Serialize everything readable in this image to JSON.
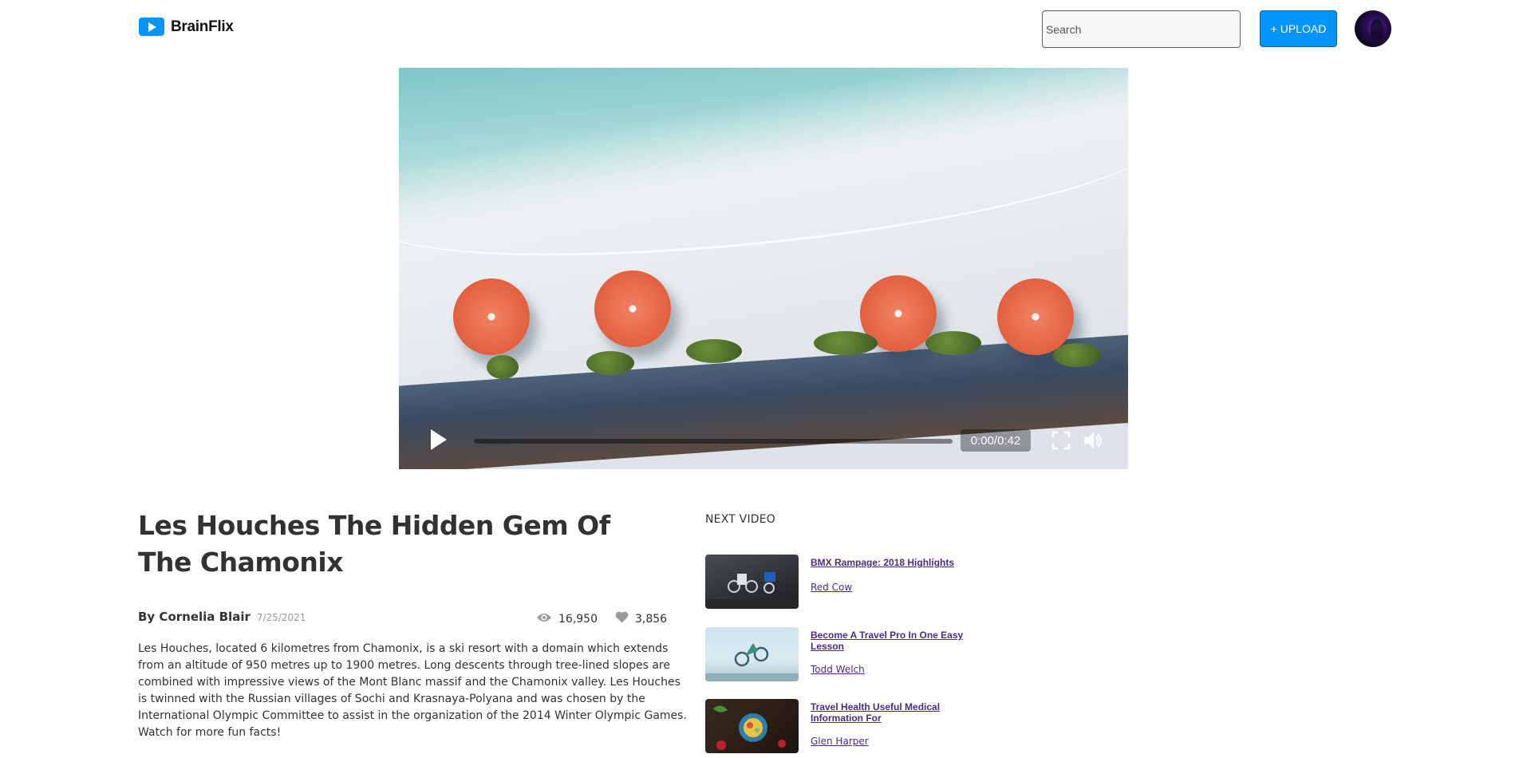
{
  "header": {
    "logo_text": "BrainFlix",
    "search_placeholder": "Search",
    "upload_label": "+ UPLOAD"
  },
  "player": {
    "time_display": "0:00/0:42",
    "progress_fraction": 0.0
  },
  "video": {
    "title": "Les Houches The Hidden Gem Of The Chamonix",
    "author": "By Cornelia Blair",
    "date": "7/25/2021",
    "views": "16,950",
    "likes": "3,856",
    "description": "Les Houches, located 6 kilometres from Chamonix, is a ski resort with a domain which extends from an altitude of 950 metres up to 1900 metres. Long descents through tree-lined slopes are combined with impressive views of the Mont Blanc massif and the Chamonix valley. Les Houches is twinned with the Russian villages of Sochi and Krasnaya-Polyana and was chosen by the International Olympic Committee to assist in the organization of the 2014 Winter Olympic Games. Watch for more fun facts!"
  },
  "next_videos": {
    "heading": "NEXT VIDEO",
    "items": [
      {
        "title": "BMX Rampage: 2018 Highlights",
        "channel": "Red Cow"
      },
      {
        "title": "Become A Travel Pro In One Easy Lesson",
        "channel": "Todd Welch"
      },
      {
        "title": "Travel Health Useful Medical Information For",
        "channel": "Glen Harper"
      }
    ]
  },
  "colors": {
    "accent": "#0095ff",
    "link": "#4b2a88",
    "text": "#323232"
  }
}
